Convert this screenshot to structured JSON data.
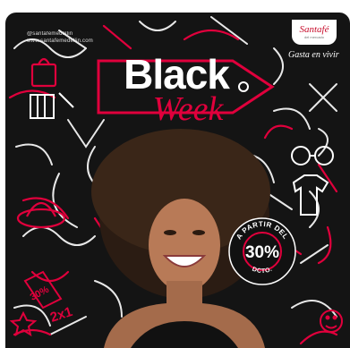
{
  "header": {
    "handle_line1": "@santafemedellin",
    "handle_line2": "www.santafemedellin.com",
    "brand": "Santafé",
    "brand_sub": "del mercado",
    "tagline": "Gasta en vivir"
  },
  "title": {
    "line1": "Black",
    "line2": "Week"
  },
  "badge": {
    "top_text": "A PARTIR DEL",
    "value": "30%",
    "bottom_text": "DCTO."
  },
  "doodles": {
    "coupon_text": "30%",
    "promo_text": "2x1"
  },
  "colors": {
    "background": "#141414",
    "accent": "#e0003c",
    "white": "#ffffff"
  },
  "icons": [
    "shopping-bag-icon",
    "lipstick-icon",
    "hat-icon",
    "glasses-icon",
    "tshirt-icon",
    "sale-tag-icon",
    "star-icon",
    "emoji-icon"
  ]
}
